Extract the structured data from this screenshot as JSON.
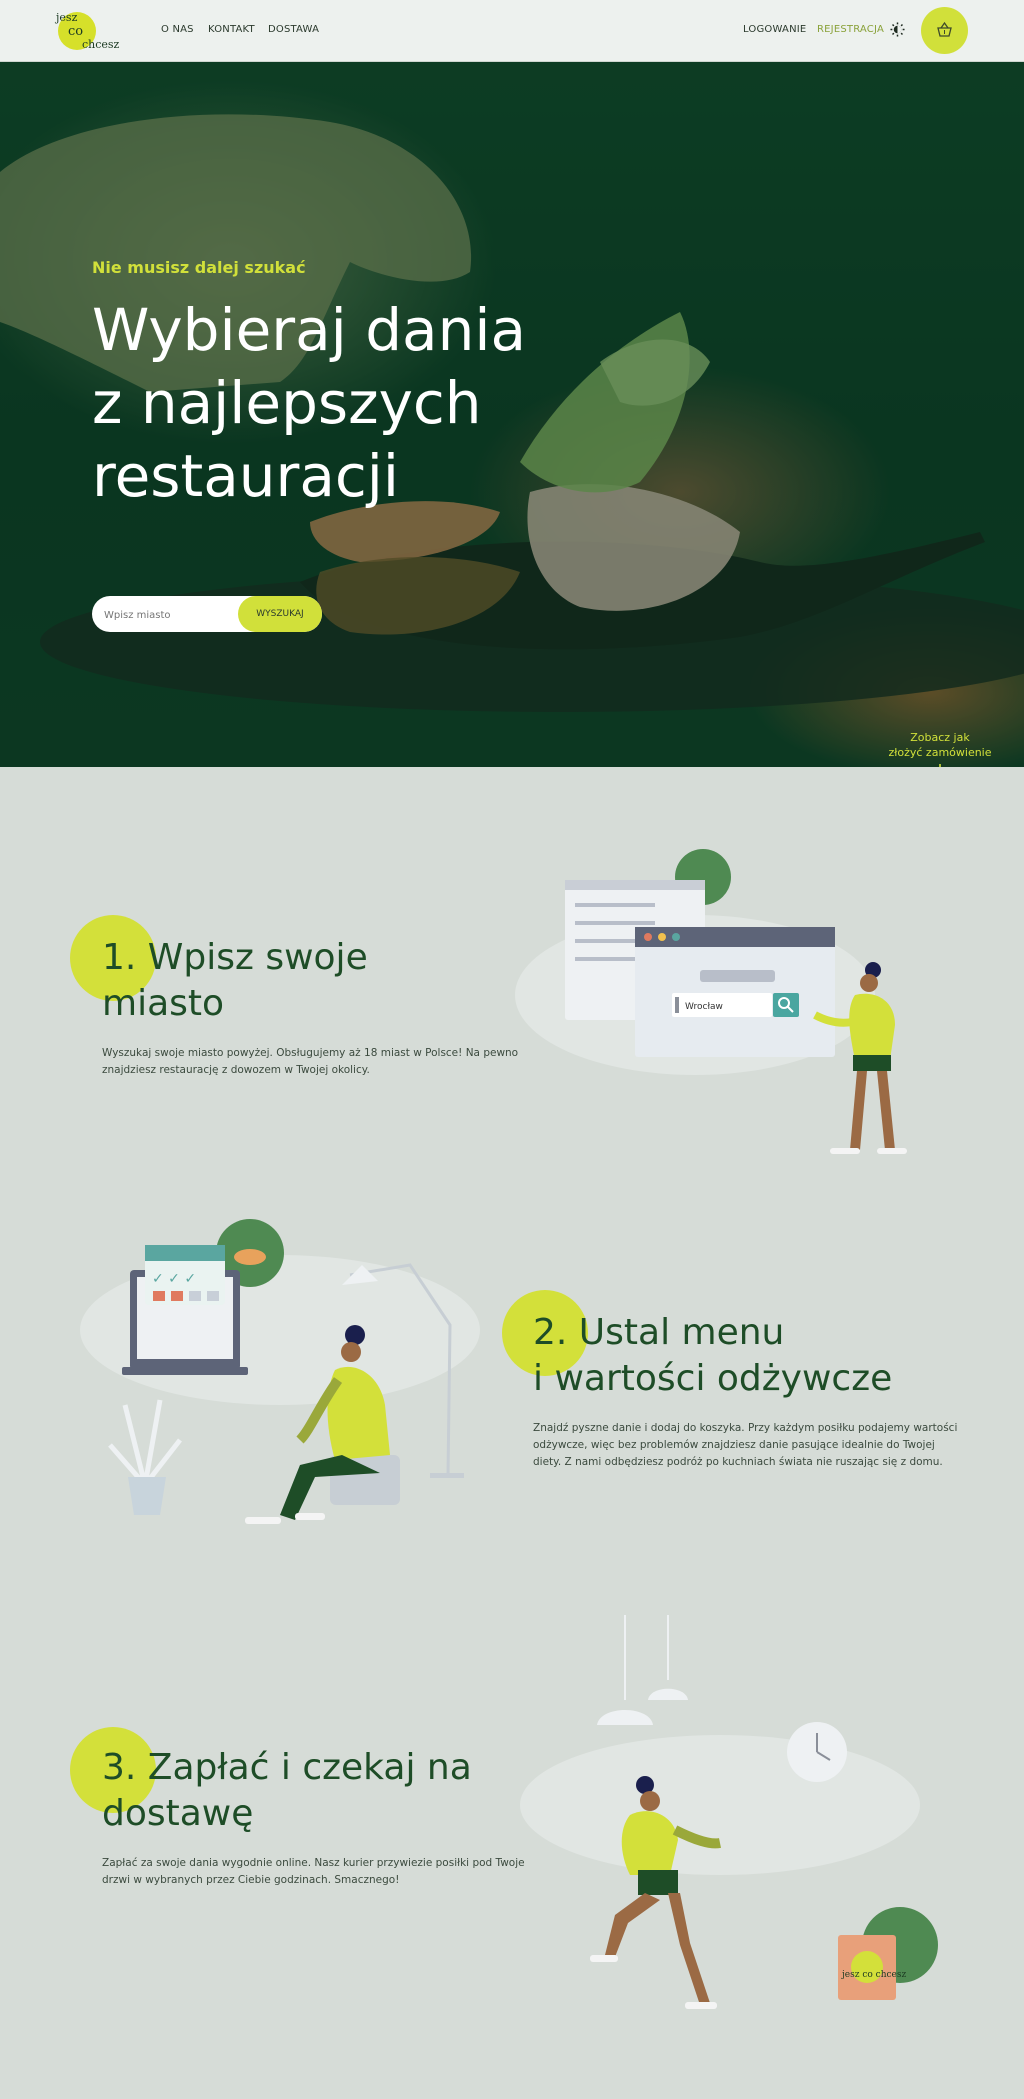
{
  "nav": {
    "logo": {
      "line1": "jesz",
      "line2": "co",
      "line3": "chcesz"
    },
    "links": [
      "O NAS",
      "KONTAKT",
      "DOSTAWA"
    ],
    "login": "LOGOWANIE",
    "register": "REJESTRACJA",
    "theme_icon": "contrast-icon",
    "cart_icon": "basket-icon"
  },
  "hero": {
    "kicker": "Nie musisz dalej szukać",
    "title_line1": "Wybieraj dania",
    "title_line2": "z najlepszych",
    "title_line3": "restauracji",
    "search_placeholder": "Wpisz miasto",
    "search_button": "WYSZUKAJ",
    "see_how_line1": "Zobacz jak",
    "see_how_line2": "złożyć zamówienie"
  },
  "steps": [
    {
      "title_line1": "1. Wpisz swoje",
      "title_line2": "miasto",
      "text_line1": "Wyszukaj swoje miasto powyżej. Obsługujemy aż 18 miast w Polsce! Na pewno",
      "text_line2": "znajdziesz restaurację z dowozem w Twojej okolicy.",
      "illustration_city": "Wrocław"
    },
    {
      "title_line1": "2. Ustal menu",
      "title_line2": "i wartości odżywcze",
      "text_line1": "Znajdź pyszne danie i dodaj do koszyka. Przy każdym posiłku podajemy wartości",
      "text_line2": "odżywcze, więc bez problemów znajdziesz danie pasujące idealnie do Twojej",
      "text_line3": "diety. Z nami odbędziesz podróż po kuchniach świata nie ruszając się z domu."
    },
    {
      "title_line1": "3. Zapłać i czekaj na",
      "title_line2": "dostawę",
      "text_line1": "Zapłać za swoje dania wygodnie online. Nasz kurier przywiezie posiłki pod Twoje",
      "text_line2": "drzwi w wybranych przez Ciebie godzinach. Smacznego!"
    }
  ],
  "colors": {
    "accent": "#d1e03a",
    "dark_green": "#1e4d27",
    "background": "#d6dcd7"
  }
}
